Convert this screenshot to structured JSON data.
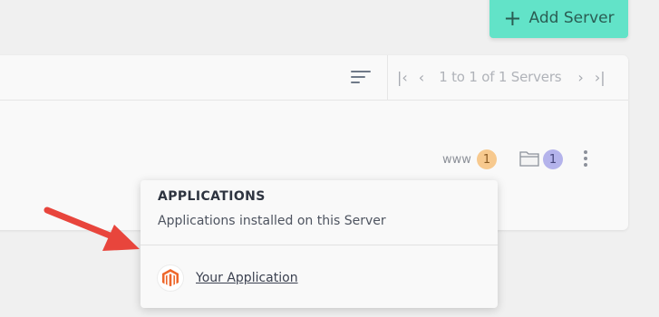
{
  "toolbar": {
    "add_server_label": "Add Server",
    "add_server_icon": "plus-icon"
  },
  "table": {
    "sort_icon": "sort-icon",
    "pagination": {
      "first_icon": "first-page-icon",
      "prev_icon": "prev-page-icon",
      "text": "1 to 1 of 1 Servers",
      "next_icon": "next-page-icon",
      "last_icon": "last-page-icon"
    }
  },
  "server_row": {
    "www_label": "www",
    "www_count": "1",
    "folder_icon": "folder-icon",
    "folder_count": "1",
    "menu_icon": "more-vertical-icon"
  },
  "applications_popover": {
    "title": "APPLICATIONS",
    "subtitle": "Applications installed on this Server",
    "items": [
      {
        "label": "Your Application",
        "icon": "magento-icon"
      }
    ]
  },
  "annotation": {
    "arrow_icon": "red-arrow-icon"
  },
  "colors": {
    "accent": "#62e3c8",
    "www_badge": "#f7c98e",
    "folder_badge": "#b4b3eb",
    "magento_orange": "#ee672b",
    "arrow_red": "#e8453c"
  }
}
